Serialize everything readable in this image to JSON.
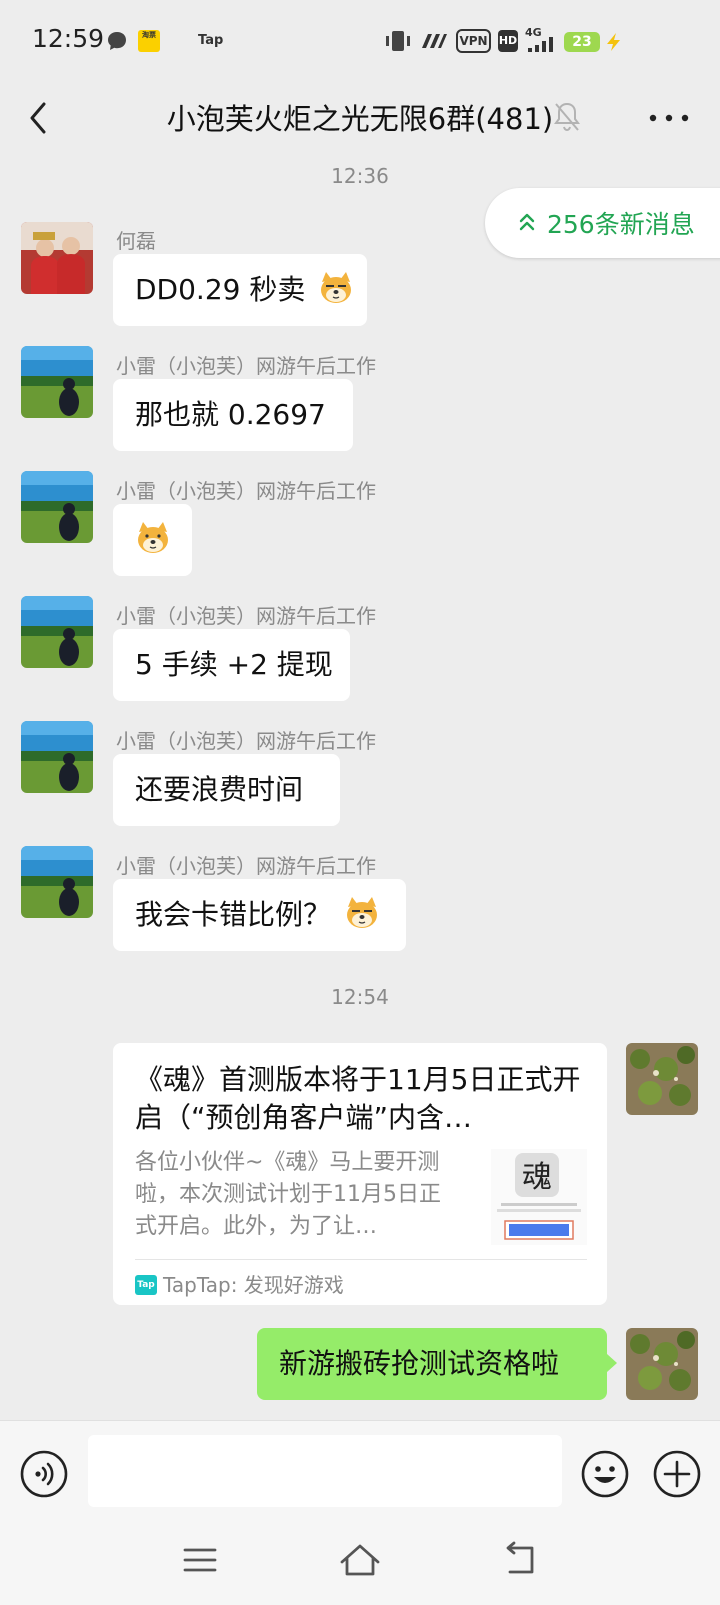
{
  "status_bar": {
    "time": "12:59",
    "app_badge": "淘票",
    "tap_label": "Tap",
    "vpn": "VPN",
    "hd": "HD",
    "network": "4G",
    "battery": "23"
  },
  "header": {
    "title": "小泡芙火炬之光无限6群(481)"
  },
  "new_messages": "256条新消息",
  "timestamps": {
    "first": "12:36",
    "second": "12:54"
  },
  "messages": [
    {
      "sender": "何磊",
      "text": "DD0.29 秒卖"
    },
    {
      "sender": "小雷（小泡芙）网游午后工作",
      "text": "那也就 0.2697"
    },
    {
      "sender": "小雷（小泡芙）网游午后工作",
      "text": ""
    },
    {
      "sender": "小雷（小泡芙）网游午后工作",
      "text": "5 手续 +2 提现"
    },
    {
      "sender": "小雷（小泡芙）网游午后工作",
      "text": "还要浪费时间"
    },
    {
      "sender": "小雷（小泡芙）网游午后工作",
      "text": "我会卡错比例？"
    }
  ],
  "link_card": {
    "title": "《魂》首测版本将于11月5日正式开启（“预创角客户端”内含…",
    "description": "各位小伙伴~《魂》马上要开测啦，本次测试计划于11月5日正式开启。此外，为了让…",
    "thumb_title": "魂",
    "source": "TapTap: 发现好游戏",
    "source_logo": "Tap"
  },
  "own_message": "新游搬砖抢测试资格啦",
  "colors": {
    "background": "#ededed",
    "bubble_green": "#95ec69",
    "new_msg_green": "#22a553"
  }
}
